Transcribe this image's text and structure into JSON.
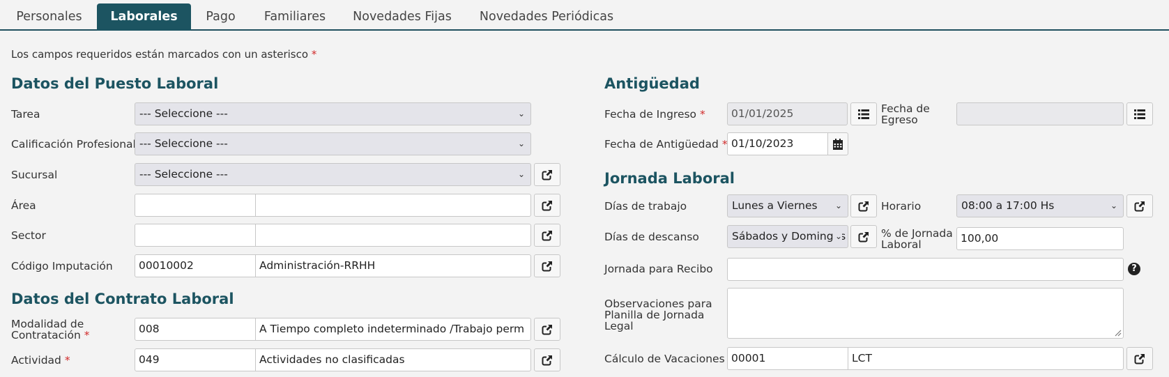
{
  "tabs": [
    {
      "label": "Personales"
    },
    {
      "label": "Laborales"
    },
    {
      "label": "Pago"
    },
    {
      "label": "Familiares"
    },
    {
      "label": "Novedades Fijas"
    },
    {
      "label": "Novedades Periódicas"
    }
  ],
  "active_tab": "Laborales",
  "required_note": "Los campos requeridos están marcados con un asterisco",
  "required_mark": "*",
  "puesto": {
    "title": "Datos del Puesto Laboral",
    "tarea": {
      "label": "Tarea",
      "value": "--- Seleccione ---"
    },
    "calificacion": {
      "label": "Calificación Profesional",
      "value": "--- Seleccione ---"
    },
    "sucursal": {
      "label": "Sucursal",
      "value": "--- Seleccione ---"
    },
    "area": {
      "label": "Área",
      "code": "",
      "desc": ""
    },
    "sector": {
      "label": "Sector",
      "code": "",
      "desc": ""
    },
    "codigo": {
      "label": "Código Imputación",
      "code": "00010002",
      "desc": "Administración-RRHH"
    }
  },
  "contrato": {
    "title": "Datos del Contrato Laboral",
    "modalidad": {
      "label_1": "Modalidad de",
      "label_2": "Contratación",
      "code": "008",
      "desc": "A Tiempo completo indeterminado /Trabajo perm"
    },
    "actividad": {
      "label": "Actividad",
      "code": "049",
      "desc": "Actividades no clasificadas"
    }
  },
  "antiguedad": {
    "title": "Antigüedad",
    "ingreso": {
      "label": "Fecha de Ingreso",
      "value": "01/01/2025"
    },
    "egreso": {
      "label_1": "Fecha de",
      "label_2": "Egreso",
      "value": ""
    },
    "fecha_antiguedad": {
      "label": "Fecha de Antigüedad",
      "value": "01/10/2023"
    }
  },
  "jornada": {
    "title": "Jornada Laboral",
    "dias_trabajo": {
      "label": "Días de trabajo",
      "value": "Lunes a Viernes"
    },
    "horario": {
      "label": "Horario",
      "value": "08:00 a 17:00 Hs"
    },
    "dias_descanso": {
      "label": "Días de descanso",
      "value": "Sábados y Domingos"
    },
    "porcentaje": {
      "label_1": "% de Jornada",
      "label_2": "Laboral",
      "value": "100,00"
    },
    "recibo": {
      "label": "Jornada para Recibo",
      "value": "",
      "help": "?"
    },
    "observaciones": {
      "label_1": "Observaciones para",
      "label_2": "Planilla de Jornada",
      "label_3": "Legal",
      "value": ""
    },
    "vacaciones": {
      "label": "Cálculo de Vacaciones",
      "code": "00001",
      "desc": "LCT"
    }
  },
  "icons": {
    "external": "external-link-icon",
    "list": "list-icon",
    "calendar": "calendar-icon",
    "chevron": "chevron-down-icon",
    "help": "help-icon"
  },
  "colors": {
    "accent": "#1c5461",
    "required": "#d12b2b",
    "background": "#f3f3f3"
  }
}
